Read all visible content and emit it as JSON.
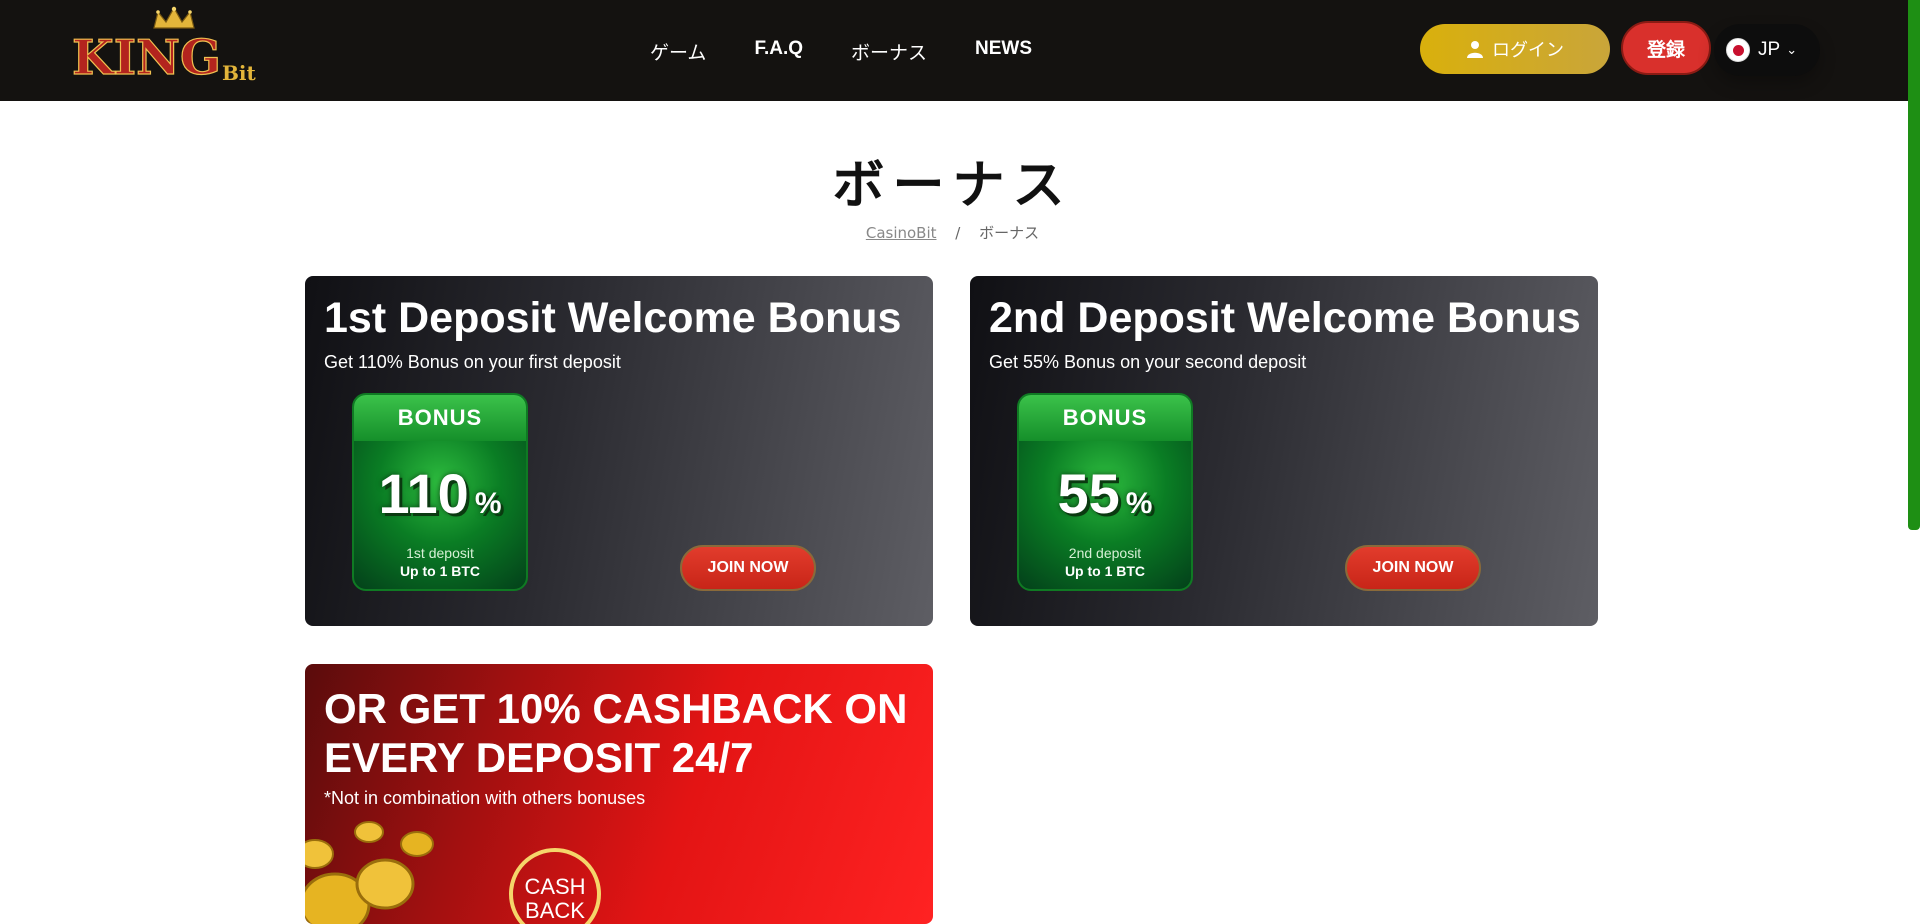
{
  "header": {
    "nav": [
      "ゲーム",
      "F.A.Q",
      "ボーナス",
      "NEWS"
    ],
    "login_label": "ログイン",
    "register_label": "登録",
    "language": "JP"
  },
  "page": {
    "title": "ボーナス",
    "breadcrumb": {
      "home": "CasinoBit",
      "separator": "/",
      "current": "ボーナス"
    }
  },
  "bonuses": [
    {
      "title": "1st Deposit Welcome Bonus",
      "subtitle": "Get 110% Bonus on your first deposit",
      "badge_label": "BONUS",
      "badge_percent": "110",
      "badge_line1": "1st deposit",
      "badge_line2": "Up to 1 BTC",
      "button": "JOIN NOW"
    },
    {
      "title": "2nd Deposit Welcome Bonus",
      "subtitle": "Get 55% Bonus on your second deposit",
      "badge_label": "BONUS",
      "badge_percent": "55",
      "badge_line1": "2nd deposit",
      "badge_line2": "Up to 1 BTC",
      "button": "JOIN NOW"
    }
  ],
  "cashback": {
    "title": "OR GET 10% CASHBACK ON EVERY DEPOSIT 24/7",
    "subtitle": "*Not in combination with others bonuses",
    "badge_text": "CASH BACK"
  },
  "colors": {
    "header_bg": "#141210",
    "login_gold": "#d9b00c",
    "register_red": "#d9302c",
    "bonus_green": "#0a7d24",
    "cashback_red": "#e31414",
    "scrollbar_green": "#1e8f14"
  },
  "logo_text": "KINGBit"
}
